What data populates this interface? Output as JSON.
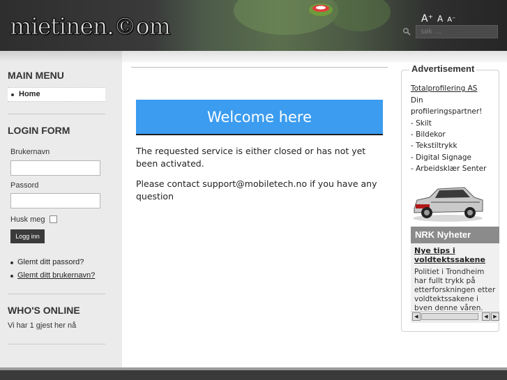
{
  "header": {
    "logo_text": "mietinen.©om",
    "font_sizer": {
      "increase": "A⁺",
      "reset": "A",
      "decrease": "A⁻"
    },
    "search_placeholder": "søk ...",
    "search_icon": "search-icon"
  },
  "sidebar": {
    "main_menu": {
      "title": "MAIN MENU",
      "items": [
        {
          "label": "Home"
        }
      ]
    },
    "login_form": {
      "title": "LOGIN FORM",
      "username_label": "Brukernavn",
      "username_value": "",
      "password_label": "Passord",
      "password_value": "",
      "remember_label": "Husk meg",
      "remember_checked": false,
      "submit_label": "Logg inn",
      "links": [
        "Glemt ditt passord?",
        "Glemt ditt brukernavn?"
      ]
    },
    "whos_online": {
      "title": "WHO'S ONLINE",
      "text": "Vi har 1 gjest her nå"
    }
  },
  "main": {
    "banner": "Welcome here",
    "message": "The requested service is either closed or has not yet been activated.",
    "contact": "Please contact support@mobiletech.no if you have any question"
  },
  "right": {
    "title": "Advertisement",
    "ad_link": "Totalprofilering AS",
    "ad_lines": [
      "Din",
      "profileringspartner!",
      "- Skilt",
      "- Bildekor",
      "- Tekstiltrykk",
      "- Digital Signage",
      "- Arbeidsklær Senter"
    ],
    "nrk": {
      "title": "NRK Nyheter",
      "headline": "Nye tips i voldtektssakene",
      "text": "Politiet i Trondheim har fullt trykk på etterforskningen etter voldtektssakene i byen denne våren."
    }
  },
  "colors": {
    "banner": "#3b9cf0",
    "sidebar": "#ebebeb",
    "header": "#2e2e2e"
  }
}
